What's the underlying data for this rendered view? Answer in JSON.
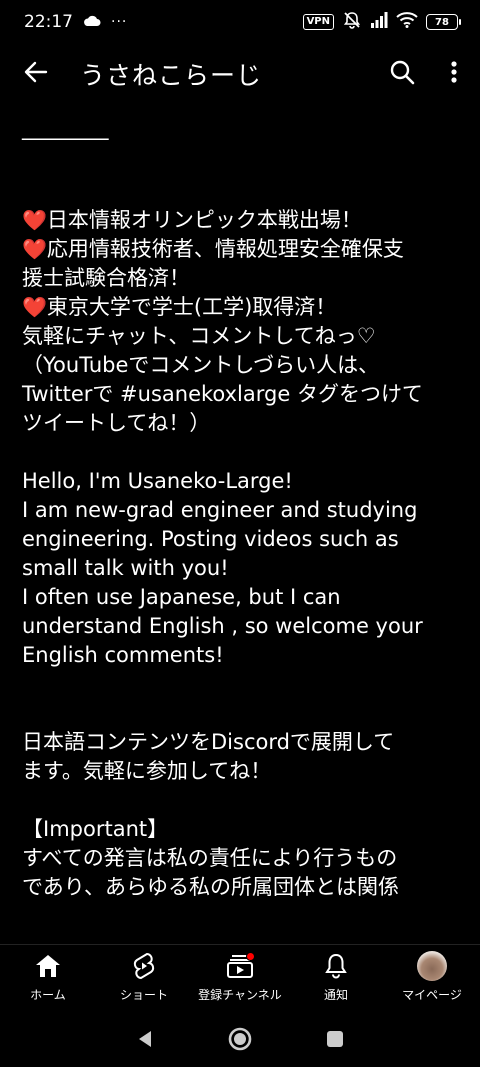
{
  "status_bar": {
    "time": "22:17",
    "more_indicator": "···",
    "vpn": "VPN",
    "battery": "78"
  },
  "app_bar": {
    "title": "うさねこらーじ"
  },
  "description": {
    "divider": "_________",
    "lines": [
      "日本情報オリンピック本戦出場！",
      "応用情報技術者、情報処理安全確保支",
      "援士試験合格済！",
      "東京大学で学士(工学)取得済！",
      "気軽にチャット、コメントしてねっ♡",
      "（YouTubeでコメントしづらい人は、",
      "Twitterで #usanekoxlarge タグをつけて",
      "ツイートしてね！）",
      "Hello, I'm Usaneko-Large!",
      "I am new-grad engineer and studying",
      "engineering. Posting videos such as",
      "small talk with you!",
      "I often use Japanese, but I can",
      "understand English , so welcome your",
      "English comments!",
      "日本語コンテンツをDiscordで展開して",
      "ます。気軽に参加してね！",
      "【Important】",
      "すべての発言は私の責任により行うもの",
      "であり、あらゆる私の所属団体とは関係"
    ]
  },
  "bottom_nav": {
    "items": [
      {
        "label": "ホーム",
        "icon": "home-icon"
      },
      {
        "label": "ショート",
        "icon": "shorts-icon"
      },
      {
        "label": "登録チャンネル",
        "icon": "subscriptions-icon"
      },
      {
        "label": "通知",
        "icon": "bell-icon"
      },
      {
        "label": "マイページ",
        "icon": "avatar"
      }
    ]
  },
  "colors": {
    "background": "#000000",
    "text": "#ffffff",
    "heart": "#e8323c",
    "notification_dot": "#ff0000"
  }
}
